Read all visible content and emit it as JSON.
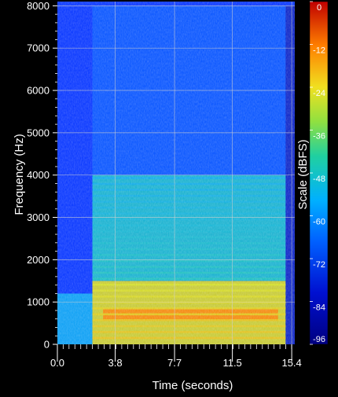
{
  "chart_data": {
    "type": "heatmap",
    "title": "",
    "xlabel": "Time (seconds)",
    "ylabel": "Frequency (Hz)",
    "colorbar_label": "Scale (dBFS)",
    "xlim": [
      0,
      15.6
    ],
    "ylim": [
      0,
      8100
    ],
    "x_ticks": [
      "0.0",
      "3.8",
      "7.7",
      "11.5",
      "15.4"
    ],
    "x_tick_values": [
      0,
      3.8,
      7.7,
      11.5,
      15.4
    ],
    "y_ticks": [
      "0",
      "1000",
      "2000",
      "3000",
      "4000",
      "5000",
      "6000",
      "7000",
      "8000"
    ],
    "y_tick_values": [
      0,
      1000,
      2000,
      3000,
      4000,
      5000,
      6000,
      7000,
      8000
    ],
    "colorbar_ticks": [
      "0",
      "-12",
      "-24",
      "-36",
      "-48",
      "-60",
      "-72",
      "-84",
      "-96"
    ],
    "colorbar_tick_values": [
      0,
      -12,
      -24,
      -36,
      -48,
      -60,
      -72,
      -84,
      -96
    ],
    "colorbar_range": [
      -96,
      0
    ],
    "grid": true,
    "energy_regions": [
      {
        "t_start": 0.0,
        "t_end": 2.3,
        "f_low": 0,
        "f_high": 1200,
        "level_dbfs": -62
      },
      {
        "t_start": 2.3,
        "t_end": 15.0,
        "f_low": 0,
        "f_high": 1500,
        "level_dbfs": -30
      },
      {
        "t_start": 3.0,
        "t_end": 14.5,
        "f_low": 550,
        "f_high": 850,
        "level_dbfs": -14
      },
      {
        "t_start": 2.3,
        "t_end": 15.0,
        "f_low": 1500,
        "f_high": 4000,
        "level_dbfs": -55
      },
      {
        "t_start": 2.3,
        "t_end": 15.0,
        "f_low": 4000,
        "f_high": 8000,
        "level_dbfs": -75
      },
      {
        "t_start": 15.0,
        "t_end": 15.6,
        "f_low": 0,
        "f_high": 8000,
        "level_dbfs": -88
      }
    ],
    "colors": {
      "background": "#000000",
      "grid": "#d0d0d0",
      "colormap": [
        "#0a0a80",
        "#0030ff",
        "#00a0ff",
        "#20d0a0",
        "#d0e020",
        "#ff9000",
        "#c01010"
      ]
    }
  }
}
